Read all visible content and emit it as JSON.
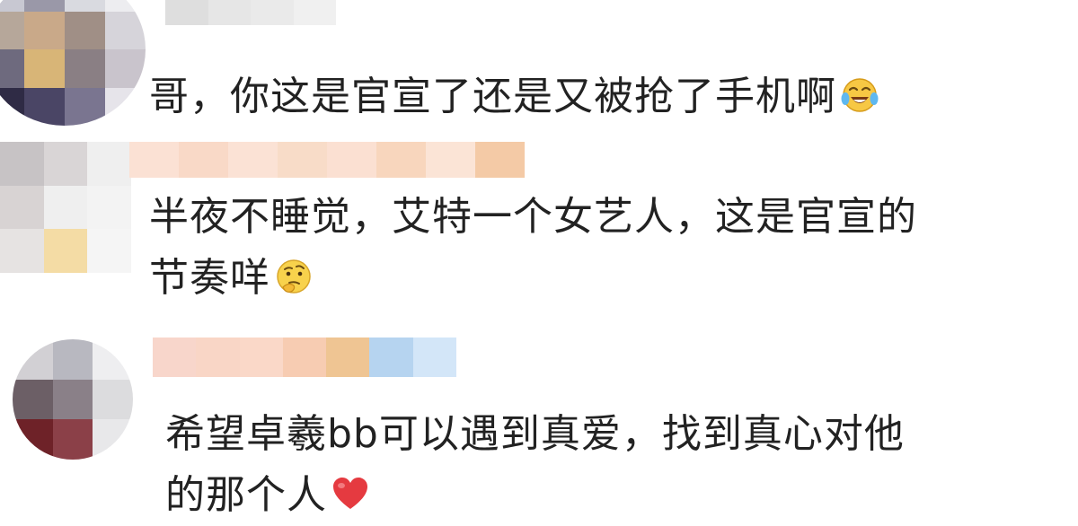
{
  "comments": [
    {
      "lines": [
        "哥，你这是官宣了还是又被抢了手机啊"
      ],
      "emoji": "laughing-crying-emoji",
      "avatar_colors": [
        "#c8c8d2",
        "#9a98a8",
        "#d9dae0",
        "#ededf0",
        "#b6a79a",
        "#c9a989",
        "#a08f86",
        "#d6d4da",
        "#6e6a7e",
        "#d8b577",
        "#8a7f84",
        "#c9c4cc",
        "#2f2b45",
        "#4a4565",
        "#7a7590",
        "#e6e4ea"
      ],
      "username_colors": [
        "#dedede",
        "#e6e6e6",
        "#eaeaea",
        "#f0f0f0"
      ]
    },
    {
      "lines": [
        "半夜不睡觉，艾特一个女艺人，这是官宣的",
        "节奏咩"
      ],
      "emoji": "thinking-emoji",
      "avatar_colors": [
        "#c7c3c5",
        "#d9d5d6",
        "#efefef",
        "#d8d3d3",
        "#efefef",
        "#f3f3f3",
        "#e6e3e2",
        "#f4dca5",
        "#f5f5f5"
      ],
      "username_colors": [
        "#fbe1d4",
        "#f9d9c7",
        "#fbe2d5",
        "#f8dcc8",
        "#fbe0d2",
        "#f8d6bd",
        "#fbe4d6",
        "#f4caa6"
      ]
    },
    {
      "lines": [
        "希望卓羲bb可以遇到真爱，找到真心对他",
        "的那个人"
      ],
      "emoji": "red-heart-emoji",
      "avatar_colors": [
        "#d2d0d4",
        "#b8b8c0",
        "#eeeef0",
        "#6c5f66",
        "#8a8088",
        "#dcdcde",
        "#6e2228",
        "#8b4048",
        "#e8e8ea"
      ],
      "username_colors": [
        "#f8d6cb",
        "#f9d6c6",
        "#fad8c8",
        "#f7ccb2",
        "#efc593",
        "#b6d4f0",
        "#d3e6f8"
      ]
    }
  ]
}
